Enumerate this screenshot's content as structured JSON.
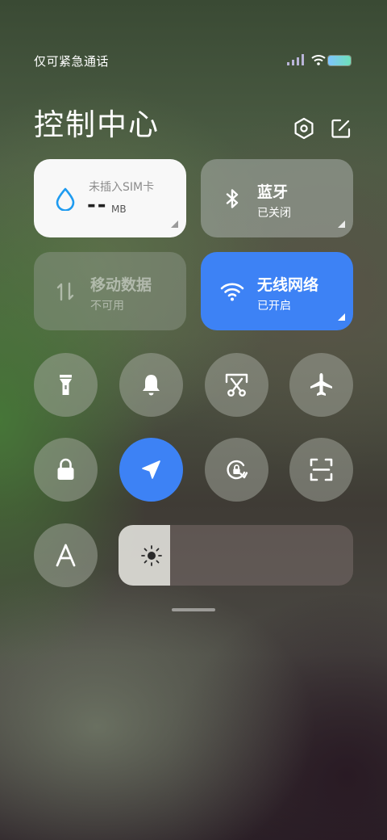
{
  "status": {
    "carrier_text": "仅可紧急通话"
  },
  "header": {
    "title": "控制中心",
    "settings_icon": "hexagon-settings-icon",
    "edit_icon": "edit-icon"
  },
  "tiles": {
    "data_usage": {
      "label": "未插入SIM卡",
      "value": "--",
      "unit": "MB",
      "icon": "water-drop-icon"
    },
    "bluetooth": {
      "title": "蓝牙",
      "status": "已关闭",
      "icon": "bluetooth-icon"
    },
    "mobile_data": {
      "title": "移动数据",
      "status": "不可用",
      "icon": "data-arrows-icon"
    },
    "wifi": {
      "title": "无线网络",
      "status": "已开启",
      "icon": "wifi-icon"
    }
  },
  "toggles": [
    {
      "name": "flashlight",
      "icon": "flashlight-icon",
      "active": false
    },
    {
      "name": "ringer",
      "icon": "bell-icon",
      "active": false
    },
    {
      "name": "screenshot",
      "icon": "scissors-icon",
      "active": false
    },
    {
      "name": "airplane-mode",
      "icon": "airplane-icon",
      "active": false
    },
    {
      "name": "lock-screen",
      "icon": "lock-icon",
      "active": false
    },
    {
      "name": "location",
      "icon": "location-arrow-icon",
      "active": true
    },
    {
      "name": "auto-rotate",
      "icon": "rotate-lock-icon",
      "active": false
    },
    {
      "name": "scanner",
      "icon": "scan-icon",
      "active": false
    },
    {
      "name": "auto-brightness",
      "icon": "letter-a-icon",
      "active": false
    }
  ],
  "brightness": {
    "level": 0.22,
    "icon": "sun-icon"
  },
  "colors": {
    "accent": "#3d82f5",
    "data_drop": "#1e9bf0"
  }
}
